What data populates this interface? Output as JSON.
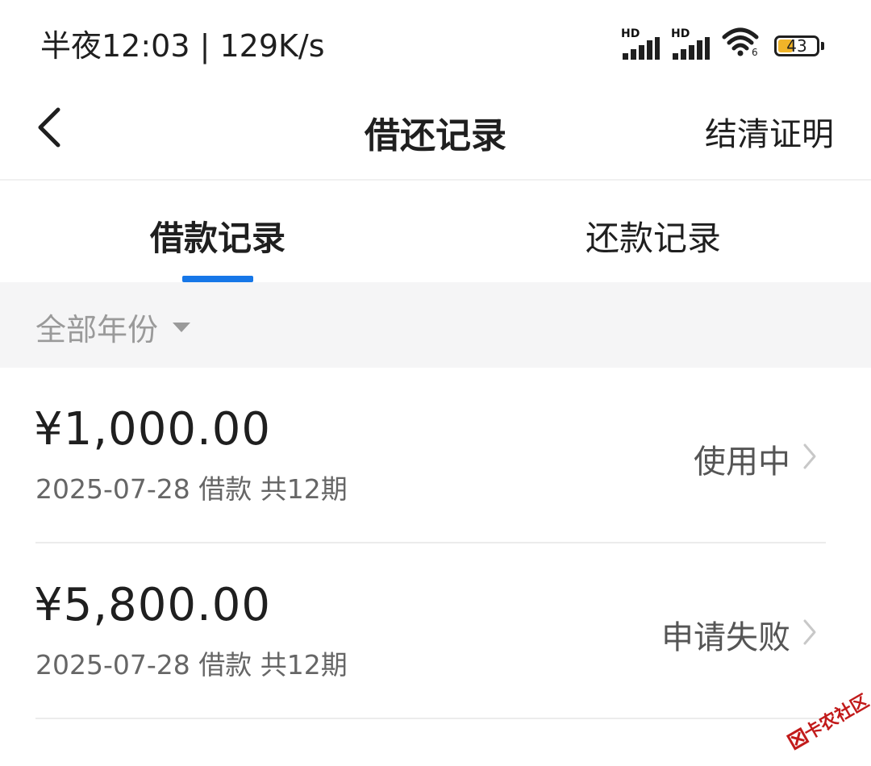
{
  "status_bar": {
    "time": "半夜12:03 | 129K/s",
    "signal_1_label": "HD",
    "signal_2_label": "HD",
    "battery_level": "43",
    "battery_percent": 43,
    "battery_color": "#f0b429"
  },
  "nav": {
    "back_icon": "chevron-left-icon",
    "title": "借还记录",
    "action_label": "结清证明"
  },
  "tabs": [
    {
      "label": "借款记录",
      "active": true
    },
    {
      "label": "还款记录",
      "active": false
    }
  ],
  "accent_color": "#1677e8",
  "filter": {
    "label": "全部年份",
    "icon": "caret-down-icon"
  },
  "records": [
    {
      "amount": "¥1,000.00",
      "subtitle": "2025-07-28 借款 共12期",
      "status": "使用中"
    },
    {
      "amount": "¥5,800.00",
      "subtitle": "2025-07-28 借款 共12期",
      "status": "申请失败"
    }
  ],
  "watermark": {
    "text": "卡农社区"
  }
}
